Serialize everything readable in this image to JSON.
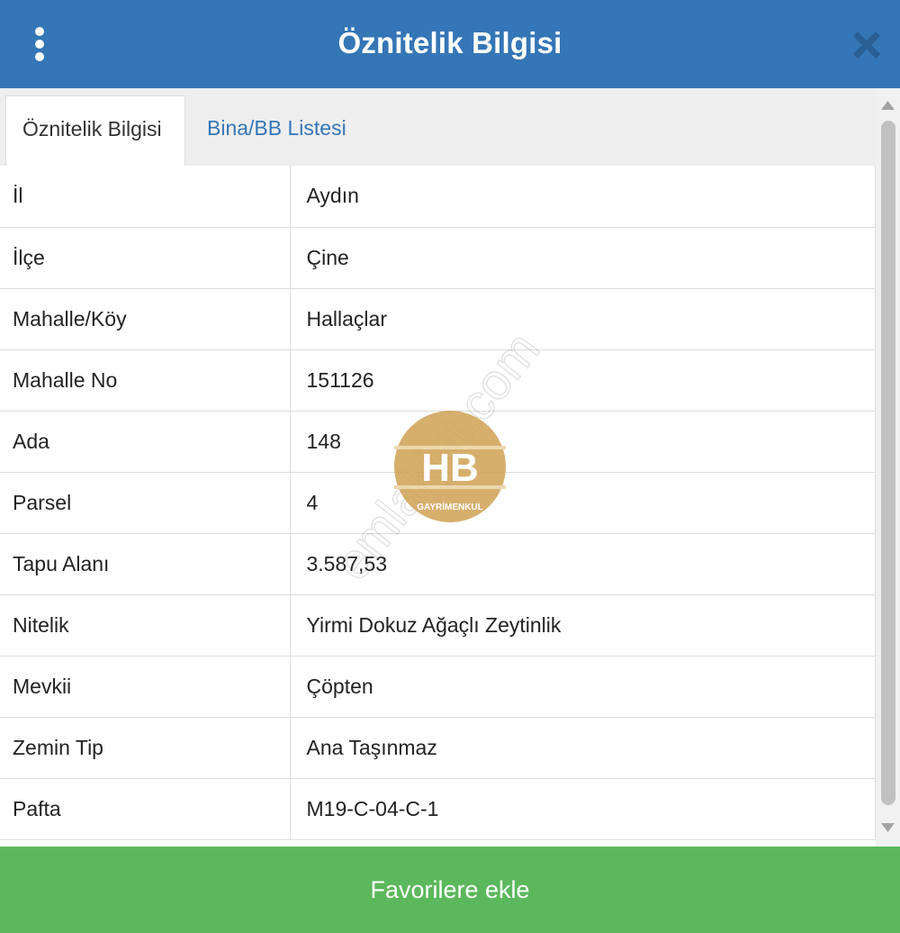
{
  "header": {
    "title": "Öznitelik Bilgisi",
    "menu_icon": "vertical-dots-icon",
    "close_icon": "close-icon",
    "background_color": "#3476b6"
  },
  "tabs": [
    {
      "label": "Öznitelik Bilgisi",
      "active": true
    },
    {
      "label": "Bina/BB Listesi",
      "active": false
    }
  ],
  "attributes": [
    {
      "key": "İl",
      "value": "Aydın"
    },
    {
      "key": "İlçe",
      "value": "Çine"
    },
    {
      "key": "Mahalle/Köy",
      "value": "Hallaçlar"
    },
    {
      "key": "Mahalle No",
      "value": "151126"
    },
    {
      "key": "Ada",
      "value": "148"
    },
    {
      "key": "Parsel",
      "value": "4"
    },
    {
      "key": "Tapu Alanı",
      "value": "3.587,53"
    },
    {
      "key": "Nitelik",
      "value": "Yirmi Dokuz Ağaçlı Zeytinlik"
    },
    {
      "key": "Mevkii",
      "value": "Çöpten"
    },
    {
      "key": "Zemin Tip",
      "value": "Ana Taşınmaz"
    },
    {
      "key": "Pafta",
      "value": "M19-C-04-C-1"
    }
  ],
  "footer": {
    "button_label": "Favorilere ekle",
    "background_color": "#5cb85c"
  },
  "watermark": {
    "logo_text": "HB",
    "logo_subtext": "GAYRİMENKUL",
    "site_text": "emlakjet.com"
  }
}
